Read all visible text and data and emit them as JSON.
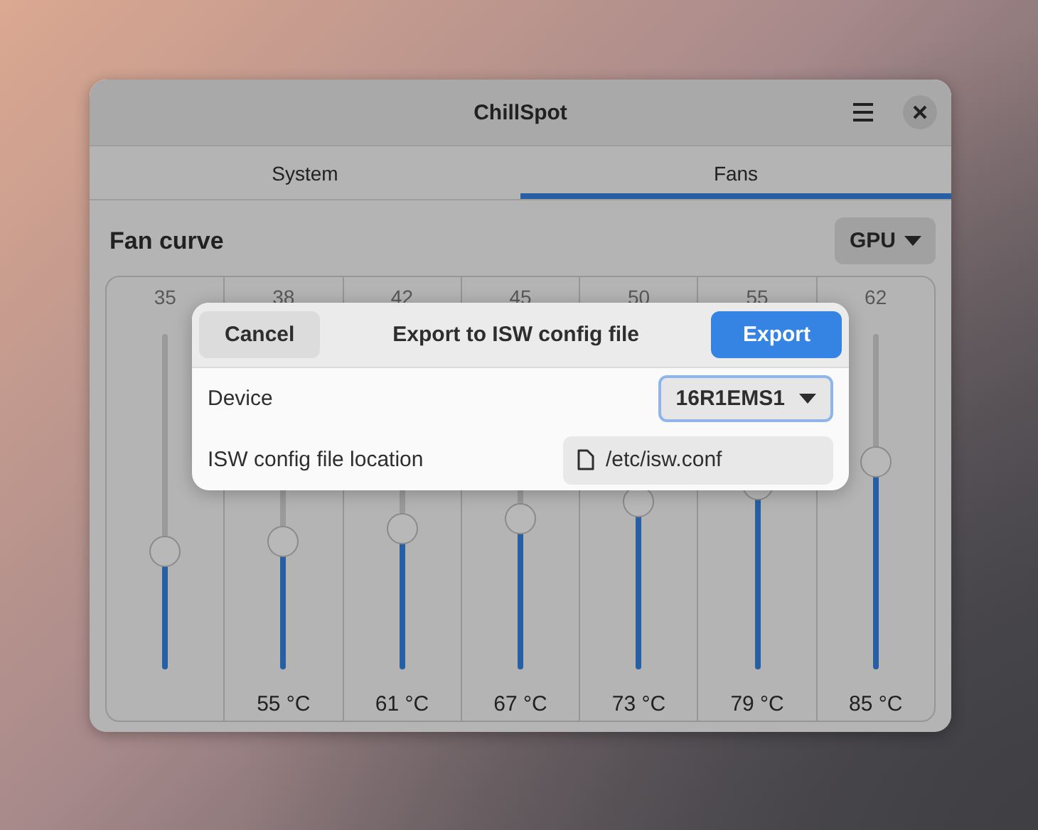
{
  "window": {
    "title": "ChillSpot"
  },
  "tabs": [
    {
      "label": "System",
      "selected": false
    },
    {
      "label": "Fans",
      "selected": true
    }
  ],
  "fan_curve": {
    "title": "Fan curve",
    "selector": "GPU",
    "points": [
      {
        "speed": "35",
        "level": 0.35
      },
      {
        "speed": "38",
        "level": 0.38,
        "temperature": "55 °C"
      },
      {
        "speed": "42",
        "level": 0.42,
        "temperature": "61 °C"
      },
      {
        "speed": "45",
        "level": 0.45,
        "temperature": "67 °C"
      },
      {
        "speed": "50",
        "level": 0.5,
        "temperature": "73 °C"
      },
      {
        "speed": "55",
        "level": 0.55,
        "temperature": "79 °C"
      },
      {
        "speed": "62",
        "level": 0.62,
        "temperature": "85 °C"
      }
    ]
  },
  "dialog": {
    "cancel": "Cancel",
    "title": "Export to ISW config file",
    "export": "Export",
    "device": {
      "label": "Device",
      "value": "16R1EMS1"
    },
    "location": {
      "label": "ISW config file location",
      "value": "/etc/isw.conf"
    }
  }
}
